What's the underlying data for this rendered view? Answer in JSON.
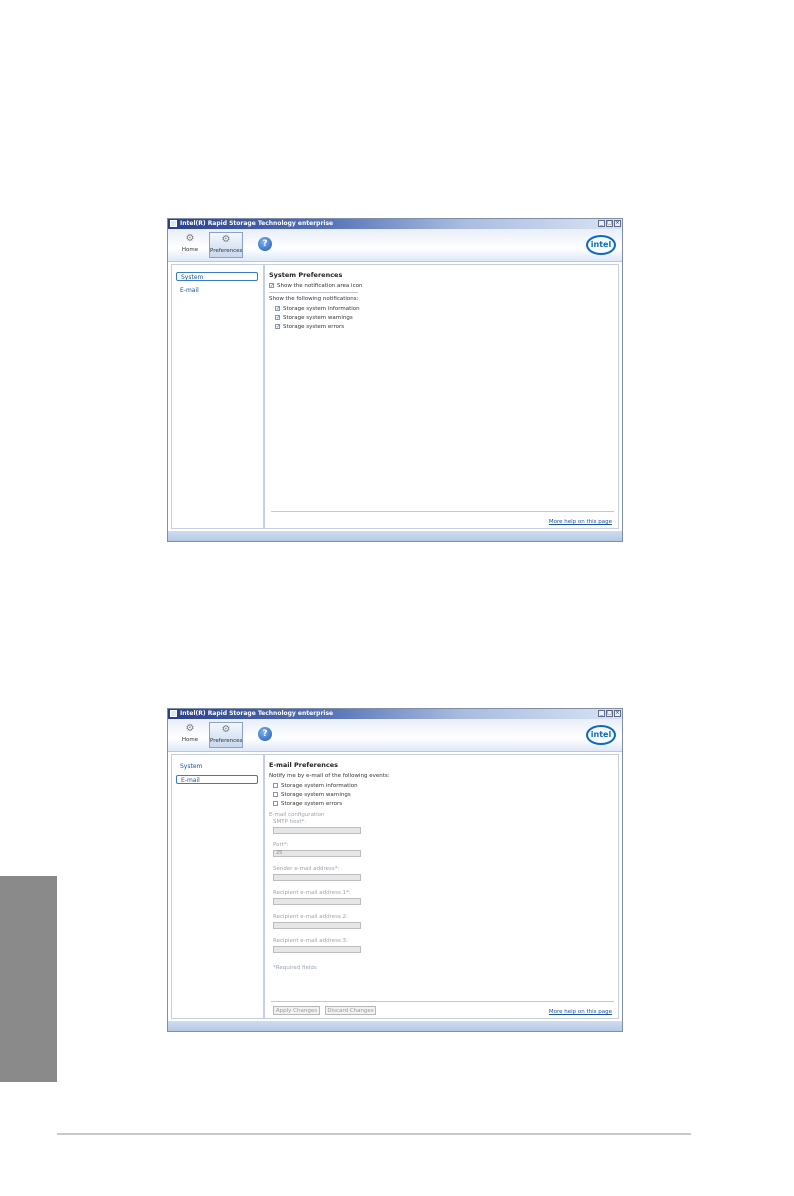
{
  "app": {
    "title": "Intel(R) Rapid Storage Technology enterprise"
  },
  "toolbar": {
    "home_label": "Home",
    "prefs_label": "Preferences",
    "help_icon": "?",
    "intel_logo": "intel"
  },
  "window_controls": {
    "minimize": "_",
    "maximize": "□",
    "close": "×"
  },
  "screen1": {
    "nav": {
      "system": "System",
      "email": "E-mail"
    },
    "title": "System Preferences",
    "show_icon": "Show the notification area icon",
    "notif_header": "Show the following notifications:",
    "notifications": [
      "Storage system information",
      "Storage system warnings",
      "Storage system errors"
    ],
    "help_link": "More help on this page"
  },
  "screen2": {
    "nav": {
      "system": "System",
      "email": "E-mail"
    },
    "title": "E-mail Preferences",
    "notify_header": "Notify me by e-mail of the following events:",
    "events": [
      "Storage system information",
      "Storage system warnings",
      "Storage system errors"
    ],
    "config_header": "E-mail configuration",
    "fields": [
      {
        "label": "SMTP host*:",
        "value": ""
      },
      {
        "label": "Port*:",
        "value": "25"
      },
      {
        "label": "Sender e-mail address*:",
        "value": ""
      },
      {
        "label": "Recipient e-mail address 1*:",
        "value": ""
      },
      {
        "label": "Recipient e-mail address 2:",
        "value": ""
      },
      {
        "label": "Recipient e-mail address 3:",
        "value": ""
      }
    ],
    "required_note": "*Required fields",
    "apply_button": "Apply Changes",
    "discard_button": "Discard Changes",
    "help_link": "More help on this page"
  }
}
